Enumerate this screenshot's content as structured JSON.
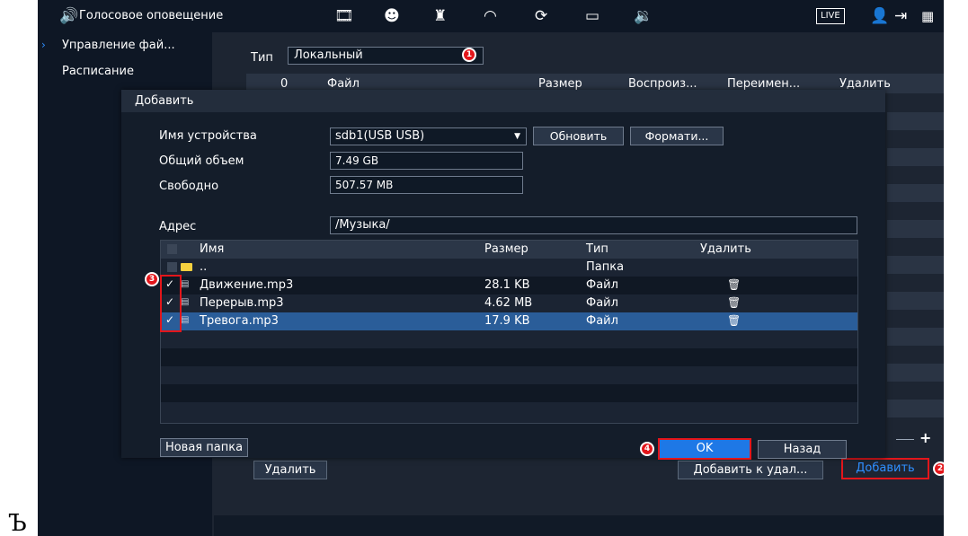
{
  "topbar": {
    "title": "Голосовое оповещение",
    "live_label": "LIVE",
    "icons": [
      "speaker-icon",
      "film-icon",
      "face-icon",
      "alarm-icon",
      "gauge-icon",
      "refresh-icon",
      "monitor-icon",
      "speaker-icon",
      "user-icon",
      "logout-icon",
      "qr-icon"
    ]
  },
  "sidebar": {
    "items": [
      {
        "label": "Управление фай..."
      },
      {
        "label": "Расписание"
      }
    ]
  },
  "background": {
    "type_label": "Тип",
    "type_value": "Локальный",
    "columns": [
      "0",
      "Файл",
      "Размер",
      "Воспроиз...",
      "Переимен...",
      "Удалить"
    ],
    "remove_label": "Удалить",
    "add_to_label": "Добавить к удал...",
    "add_label": "Добавить"
  },
  "dialog": {
    "title": "Добавить",
    "device_label": "Имя устройства",
    "device_value": "sdb1(USB USB)",
    "refresh_label": "Обновить",
    "format_label": "Формати...",
    "total_label": "Общий объем",
    "total_value": "7.49 GB",
    "free_label": "Свободно",
    "free_value": "507.57 MB",
    "address_label": "Адрес",
    "address_value": "/Музыка/",
    "table": {
      "headers": [
        "Имя",
        "Размер",
        "Тип",
        "Удалить"
      ],
      "rows": [
        {
          "name": "..",
          "size": "",
          "type": "Папка"
        },
        {
          "name": "Движение.mp3",
          "size": "28.1 KB",
          "type": "Файл"
        },
        {
          "name": "Перерыв.mp3",
          "size": "4.62 MB",
          "type": "Файл"
        },
        {
          "name": "Тревога.mp3",
          "size": "17.9 KB",
          "type": "Файл"
        }
      ]
    },
    "new_folder_label": "Новая папка",
    "ok_label": "OK",
    "back_label": "Назад"
  },
  "markers": [
    "1",
    "2",
    "3",
    "4"
  ],
  "colors": {
    "accent": "#1e78e6",
    "highlight": "#e3161b",
    "panel": "#141d2a"
  },
  "stray_char": "Ъ"
}
